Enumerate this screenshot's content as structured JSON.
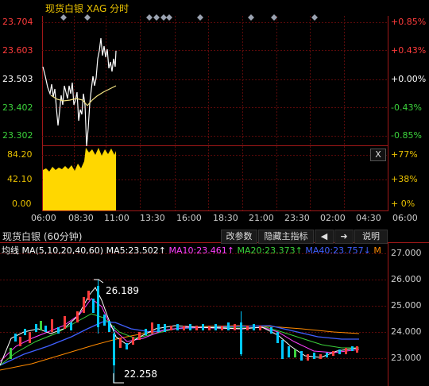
{
  "intraday": {
    "title": "现货白银 XAG 分时",
    "price_ticks": [
      {
        "label": "23.704",
        "pct": "+0.85%",
        "color": "#ff3b3b"
      },
      {
        "label": "23.603",
        "pct": "+0.43%",
        "color": "#ff3b3b"
      },
      {
        "label": "23.503",
        "pct": "+0.00%",
        "color": "#ffffff"
      },
      {
        "label": "23.402",
        "pct": "-0.43%",
        "color": "#3bd13b"
      },
      {
        "label": "23.302",
        "pct": "-0.85%",
        "color": "#3bd13b"
      }
    ],
    "volume_ticks": [
      {
        "label": "84.20",
        "pct": "+77%"
      },
      {
        "label": "42.10",
        "pct": "+38%"
      },
      {
        "label": "0.00",
        "pct": "+ 0%"
      }
    ],
    "close_button": "X",
    "time_ticks": [
      "06:00",
      "08:30",
      "11:00",
      "13:30",
      "16:00",
      "18:30",
      "21:00",
      "23:30",
      "02:00",
      "04:30",
      "06:00"
    ],
    "colors": {
      "up": "#ff3b3b",
      "down": "#3bd13b",
      "volume": "#ffd700",
      "price_line": "#ffffff",
      "avg_line": "#f0e080",
      "label": "#e8c000"
    }
  },
  "kline": {
    "title": "现货白银 (60分钟)",
    "toolbar": {
      "params": "改参数",
      "hide": "隐藏主指标",
      "left": "◀",
      "right": "➜",
      "help": "说明"
    },
    "legend": [
      {
        "text": "均线 MA(5,10,20,40,60)",
        "color": "#ffffff"
      },
      {
        "text": "MA5:23.502↑",
        "color": "#ffffff"
      },
      {
        "text": "MA10:23.461↑",
        "color": "#ff40ff"
      },
      {
        "text": "MA20:23.373↑",
        "color": "#3bd13b"
      },
      {
        "text": "MA40:23.757↓",
        "color": "#4060ff"
      },
      {
        "text": "M",
        "color": "#ff8a00"
      }
    ],
    "price_ticks": [
      "27.000",
      "26.000",
      "25.000",
      "24.000",
      "23.000"
    ],
    "high_label": "26.189",
    "low_label": "22.258"
  }
}
